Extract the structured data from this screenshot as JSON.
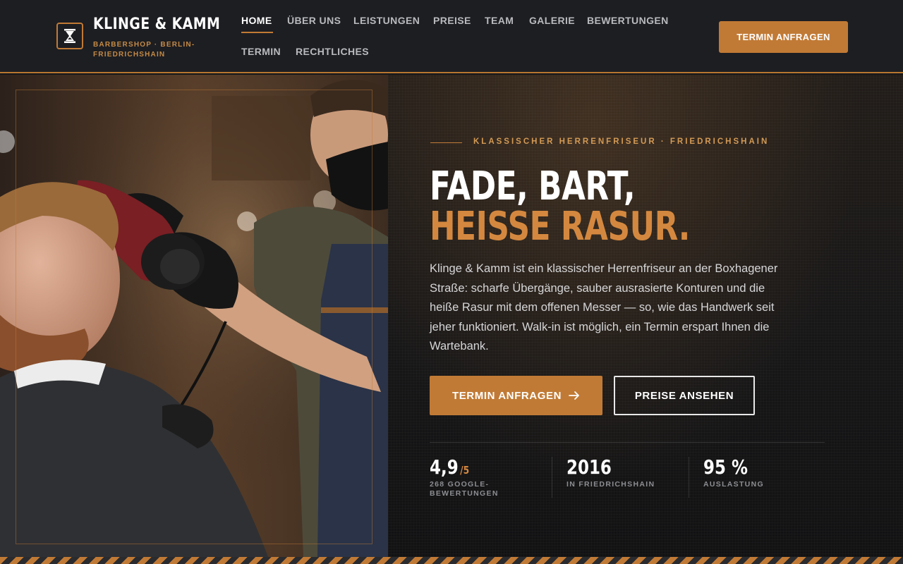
{
  "brand": {
    "name": "KLINGE & KAMM",
    "tagline": "BARBERSHOP · BERLIN-FRIEDRICHSHAIN",
    "logo_icon": "hourglass-icon"
  },
  "nav": {
    "items": [
      {
        "label": "HOME",
        "active": true
      },
      {
        "label": "ÜBER UNS"
      },
      {
        "label": "LEISTUNGEN"
      },
      {
        "label": "PREISE"
      },
      {
        "label": "TEAM"
      },
      {
        "label": "GALERIE"
      },
      {
        "label": "BEWERTUNGEN"
      },
      {
        "label": "TERMIN"
      },
      {
        "label": "RECHTLICHES"
      }
    ],
    "cta_label": "TERMIN ANFRAGEN"
  },
  "hero": {
    "eyebrow": "KLASSISCHER HERRENFRISEUR · FRIEDRICHSHAIN",
    "headline_line1": "FADE, BART,",
    "headline_line2": "HEISSE RASUR.",
    "lead": "Klinge & Kamm ist ein klassischer Herrenfriseur an der Boxhagener Straße: scharfe Übergänge, sauber ausrasierte Konturen und die heiße Rasur mit dem offenen Messer — so, wie das Handwerk seit jeher funktioniert. Walk-in ist möglich, ein Termin erspart Ihnen die Wartebank.",
    "primary_button": "TERMIN ANFRAGEN",
    "primary_button_icon": "arrow-right-icon",
    "secondary_button": "PREISE ANSEHEN"
  },
  "stats": [
    {
      "value": "4,9",
      "suffix": "/5",
      "label": "268 GOOGLE-BEWERTUNGEN"
    },
    {
      "value": "2016",
      "suffix": "",
      "label": "IN FRIEDRICHSHAIN"
    },
    {
      "value": "95 %",
      "suffix": "",
      "label": "AUSLASTUNG"
    }
  ],
  "colors": {
    "accent": "#c17a35",
    "headline_accent": "#d4883f",
    "header_bg": "#1d1e22",
    "hero_bg": "#161617"
  }
}
